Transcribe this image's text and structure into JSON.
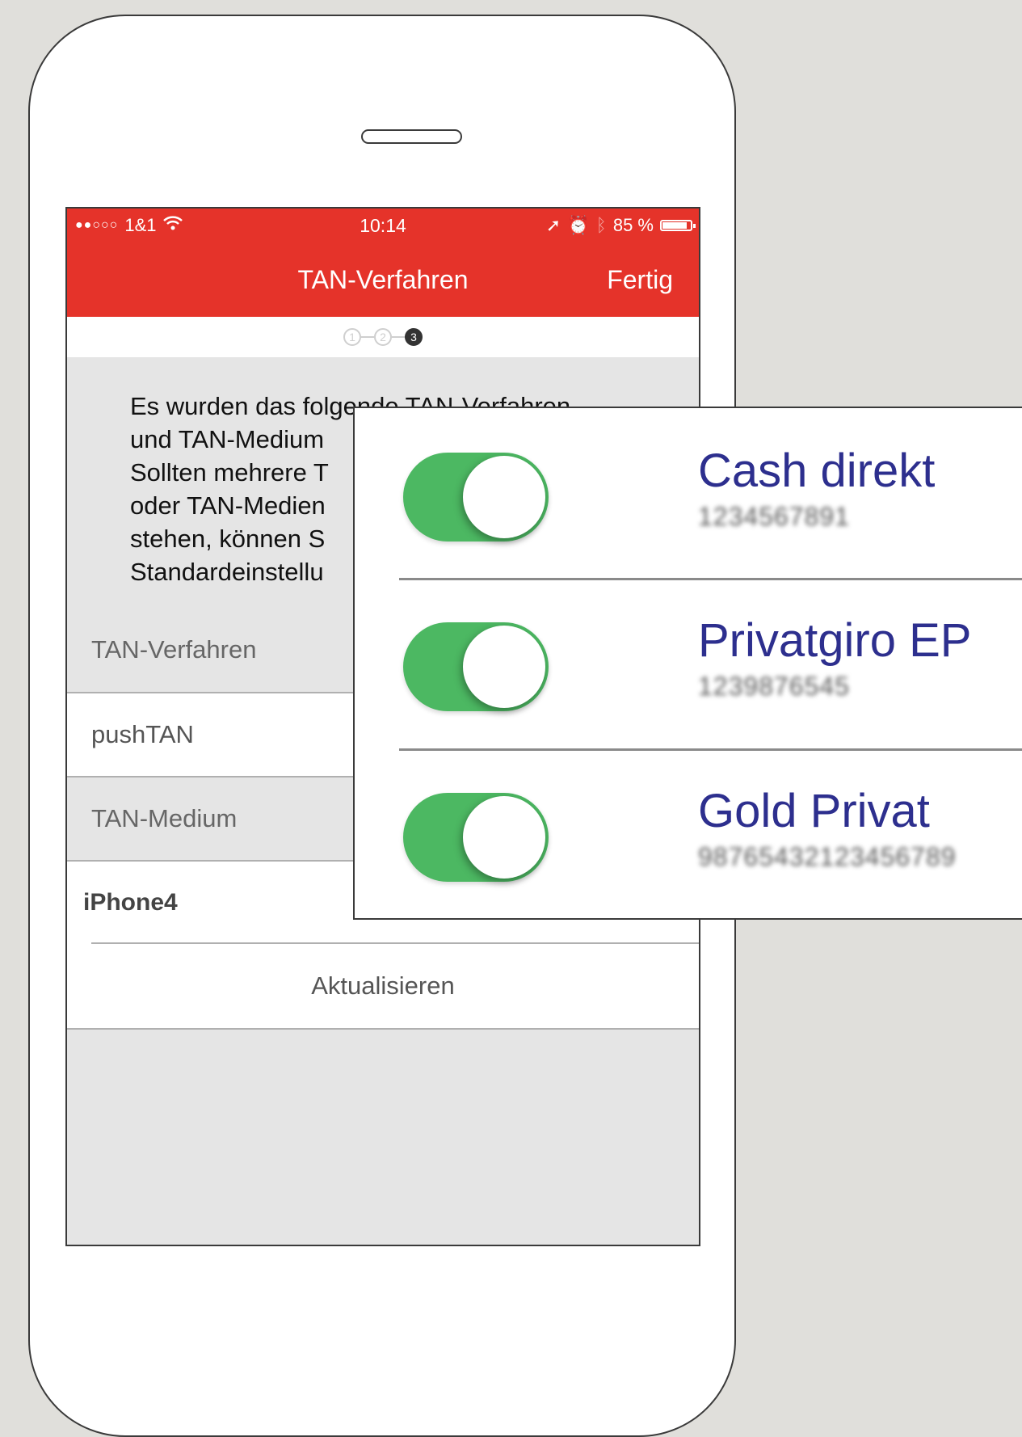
{
  "status_bar": {
    "carrier": "1&1",
    "time": "10:14",
    "battery": "85 %"
  },
  "nav": {
    "title": "TAN-Verfahren",
    "done_label": "Fertig"
  },
  "stepper": {
    "steps": [
      "1",
      "2",
      "3"
    ],
    "active_step": 3
  },
  "intro_lines": [
    "Es wurden das folgende TAN-Verfahren",
    "und TAN-Medium",
    "Sollten mehrere T",
    "oder TAN-Medien",
    "stehen, können S",
    "Standardeinstellu"
  ],
  "sections": {
    "tan_method_header": "TAN-Verfahren",
    "tan_method_value": "pushTAN",
    "tan_medium_header": "TAN-Medium",
    "tan_medium_value": "iPhone4",
    "refresh_button": "Aktualisieren"
  },
  "accounts": [
    {
      "name": "Cash direkt",
      "number": "1234567891",
      "enabled": true
    },
    {
      "name": "Privatgiro EP",
      "number": "1239876545",
      "enabled": true
    },
    {
      "name": "Gold Privat",
      "number": "98765432123456789",
      "enabled": true
    }
  ],
  "colors": {
    "nav_red": "#e5332a",
    "toggle_green": "#4cb862",
    "account_name": "#2d2f8e"
  }
}
